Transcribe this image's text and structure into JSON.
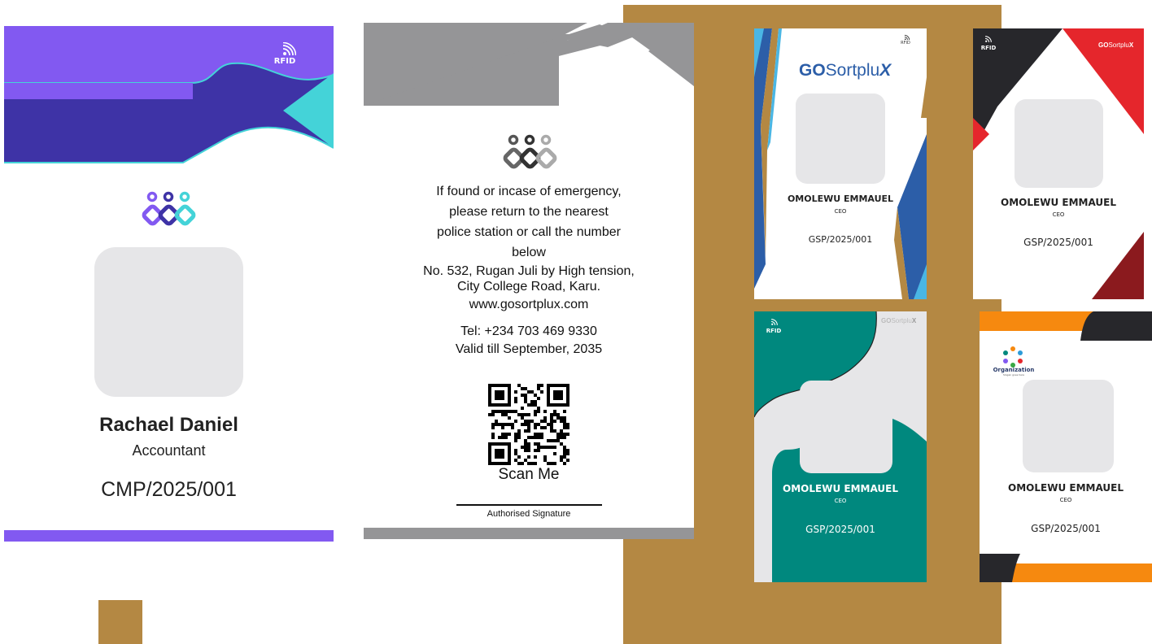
{
  "colors": {
    "brand_purple": "#8259F1",
    "dark_purple": "#3E33A6",
    "teal_accent": "#44D3D8",
    "gold_background": "#B48843",
    "gray_band": "#959597",
    "blue": "#2C5EA8",
    "red": "#E5262C",
    "dark_red": "#8B1A1E",
    "teal_green": "#00887E",
    "orange": "#F6890F",
    "charcoal": "#27272B"
  },
  "front_card": {
    "rfid_label": "RFID",
    "name": "Rachael Daniel",
    "role": "Accountant",
    "code": "CMP/2025/001",
    "logo_icon": "rings-logo-icon",
    "wifi_icon": "rfid-signal-icon"
  },
  "back_card": {
    "logo_icon": "rings-logo-icon",
    "message_lines": [
      "If found or incase of emergency,",
      "please return to the nearest",
      "police station or call the number",
      "below"
    ],
    "address_lines": [
      "No. 532, Rugan Juli by High tension,",
      "City College Road, Karu."
    ],
    "website": "www.gosortplux.com",
    "tel": "Tel: +234 703 469 9330",
    "valid": "Valid till September, 2035",
    "qr_icon": "qr-code-icon",
    "qr_caption": "Scan Me",
    "signature_label": "Authorised Signature"
  },
  "thumbnails": {
    "blue": {
      "brand_go": "GO",
      "brand_rest": "Sortplu",
      "brand_x": "X",
      "rfid_label": "RFID",
      "name": "OMOLEWU EMMAUEL",
      "role": "CEO",
      "code": "GSP/2025/001"
    },
    "red": {
      "rfid_label": "RFID",
      "brand_go": "GO",
      "brand_rest": "Sortplu",
      "brand_x": "X",
      "name": "OMOLEWU EMMAUEL",
      "role": "CEO",
      "code": "GSP/2025/001"
    },
    "teal": {
      "rfid_label": "RFID",
      "brand_go": "GO",
      "brand_rest": "Sortplu",
      "brand_x": "X",
      "name": "OMOLEWU EMMAUEL",
      "role": "CEO",
      "code": "GSP/2025/001"
    },
    "orange": {
      "org_label": "Organization",
      "org_tagline": "Slogan goes here",
      "name": "OMOLEWU EMMAUEL",
      "role": "CEO",
      "code": "GSP/2025/001"
    }
  }
}
